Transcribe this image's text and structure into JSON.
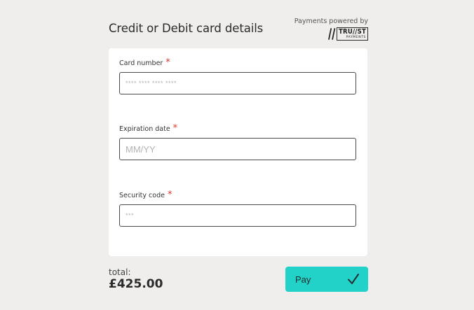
{
  "header": {
    "title": "Credit or Debit card details",
    "powered_by": "Payments powered by",
    "logo_word": "TRU//ST",
    "logo_sub": "PAYMENTS"
  },
  "form": {
    "card_number": {
      "label": "Card number",
      "required_mark": "*",
      "placeholder": "**** **** **** ****"
    },
    "expiration_date": {
      "label": "Expiration date",
      "required_mark": "*",
      "placeholder": "MM/YY"
    },
    "security_code": {
      "label": "Security code",
      "required_mark": "*",
      "placeholder": "***"
    }
  },
  "footer": {
    "total_label": "total:",
    "total_amount": "£425.00",
    "pay_label": "Pay"
  },
  "icons": {
    "pay": "checkmark-icon",
    "logo": "trust-payments-logo"
  },
  "colors": {
    "background": "#efeeed",
    "panel": "#ffffff",
    "accent": "#22d1c8",
    "required": "#e0362c",
    "input_border": "#4a4a4a"
  }
}
